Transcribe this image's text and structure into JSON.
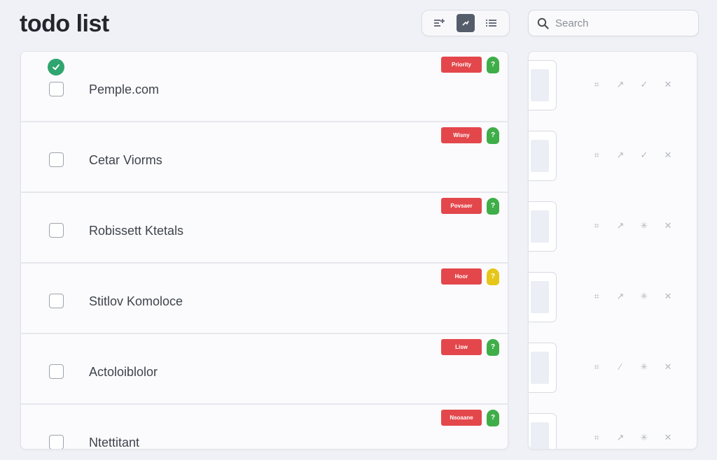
{
  "title": "todo list",
  "search": {
    "placeholder": "Search"
  },
  "colors": {
    "accent_done": "#2fa56f",
    "priority": "#e3474b",
    "tag_green": "#3fae49",
    "tag_yellow": "#e6c619"
  },
  "todos": [
    {
      "label": "Pemple.com",
      "priority": "Priority",
      "tag": "?",
      "tag_color": "green",
      "completed_badge": true
    },
    {
      "label": "Cetar Viorms",
      "priority": "Wisny",
      "tag": "?",
      "tag_color": "green",
      "completed_badge": false
    },
    {
      "label": "Robissett Ktetals",
      "priority": "Povsaer",
      "tag": "?",
      "tag_color": "green",
      "completed_badge": false
    },
    {
      "label": "Stitlov Komoloce",
      "priority": "Hoor",
      "tag": "?",
      "tag_color": "yellow",
      "completed_badge": false
    },
    {
      "label": "Actoloiblolor",
      "priority": "Lisw",
      "tag": "?",
      "tag_color": "green",
      "completed_badge": false
    },
    {
      "label": "Ntettitant",
      "priority": "Nsoaane",
      "tag": "?",
      "tag_color": "green",
      "completed_badge": false
    }
  ]
}
